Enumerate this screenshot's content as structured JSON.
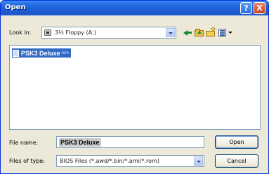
{
  "window": {
    "title": "Open"
  },
  "titlebar": {
    "help": "?",
    "close": "X"
  },
  "lookin": {
    "label": "Look in:",
    "value": "3½ Floppy (A:)"
  },
  "files": [
    {
      "name": "PSK3 Deluxe",
      "ext": "rom"
    }
  ],
  "filename": {
    "label": "File name:",
    "value": "PSK3 Deluxe"
  },
  "filetype": {
    "label": "Files of type:",
    "value": "BIOS Files (*.awd/*.bin/*.ami/*.rom)"
  },
  "buttons": {
    "open": "Open",
    "cancel": "Cancel"
  },
  "colors": {
    "titlebar": "#1f5fd6",
    "selection": "#316ac5",
    "dialog": "#ece9d8"
  },
  "icons": {
    "toolbar": [
      "back-icon",
      "up-folder-icon",
      "new-folder-icon",
      "views-menu-icon"
    ],
    "drive": "floppy-drive-icon",
    "file": "file-icon"
  }
}
